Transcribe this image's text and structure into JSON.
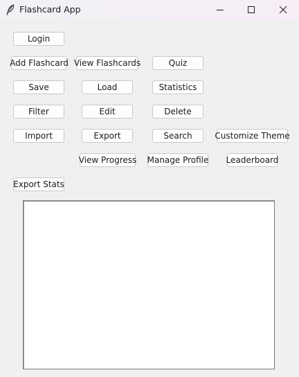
{
  "window": {
    "title": "Flashcard App",
    "icon": "feather-icon"
  },
  "buttons": {
    "login": "Login",
    "add_flashcard": "Add Flashcard",
    "view_flashcards": "View Flashcards",
    "quiz": "Quiz",
    "save": "Save",
    "load": "Load",
    "statistics": "Statistics",
    "filter": "Filter",
    "edit": "Edit",
    "delete": "Delete",
    "import": "Import",
    "export": "Export",
    "search": "Search",
    "customize_theme": "Customize Theme",
    "view_progress": "View Progress",
    "manage_profile": "Manage Profile",
    "leaderboard": "Leaderboard",
    "export_stats": "Export Stats"
  },
  "output_area": {
    "content": ""
  }
}
